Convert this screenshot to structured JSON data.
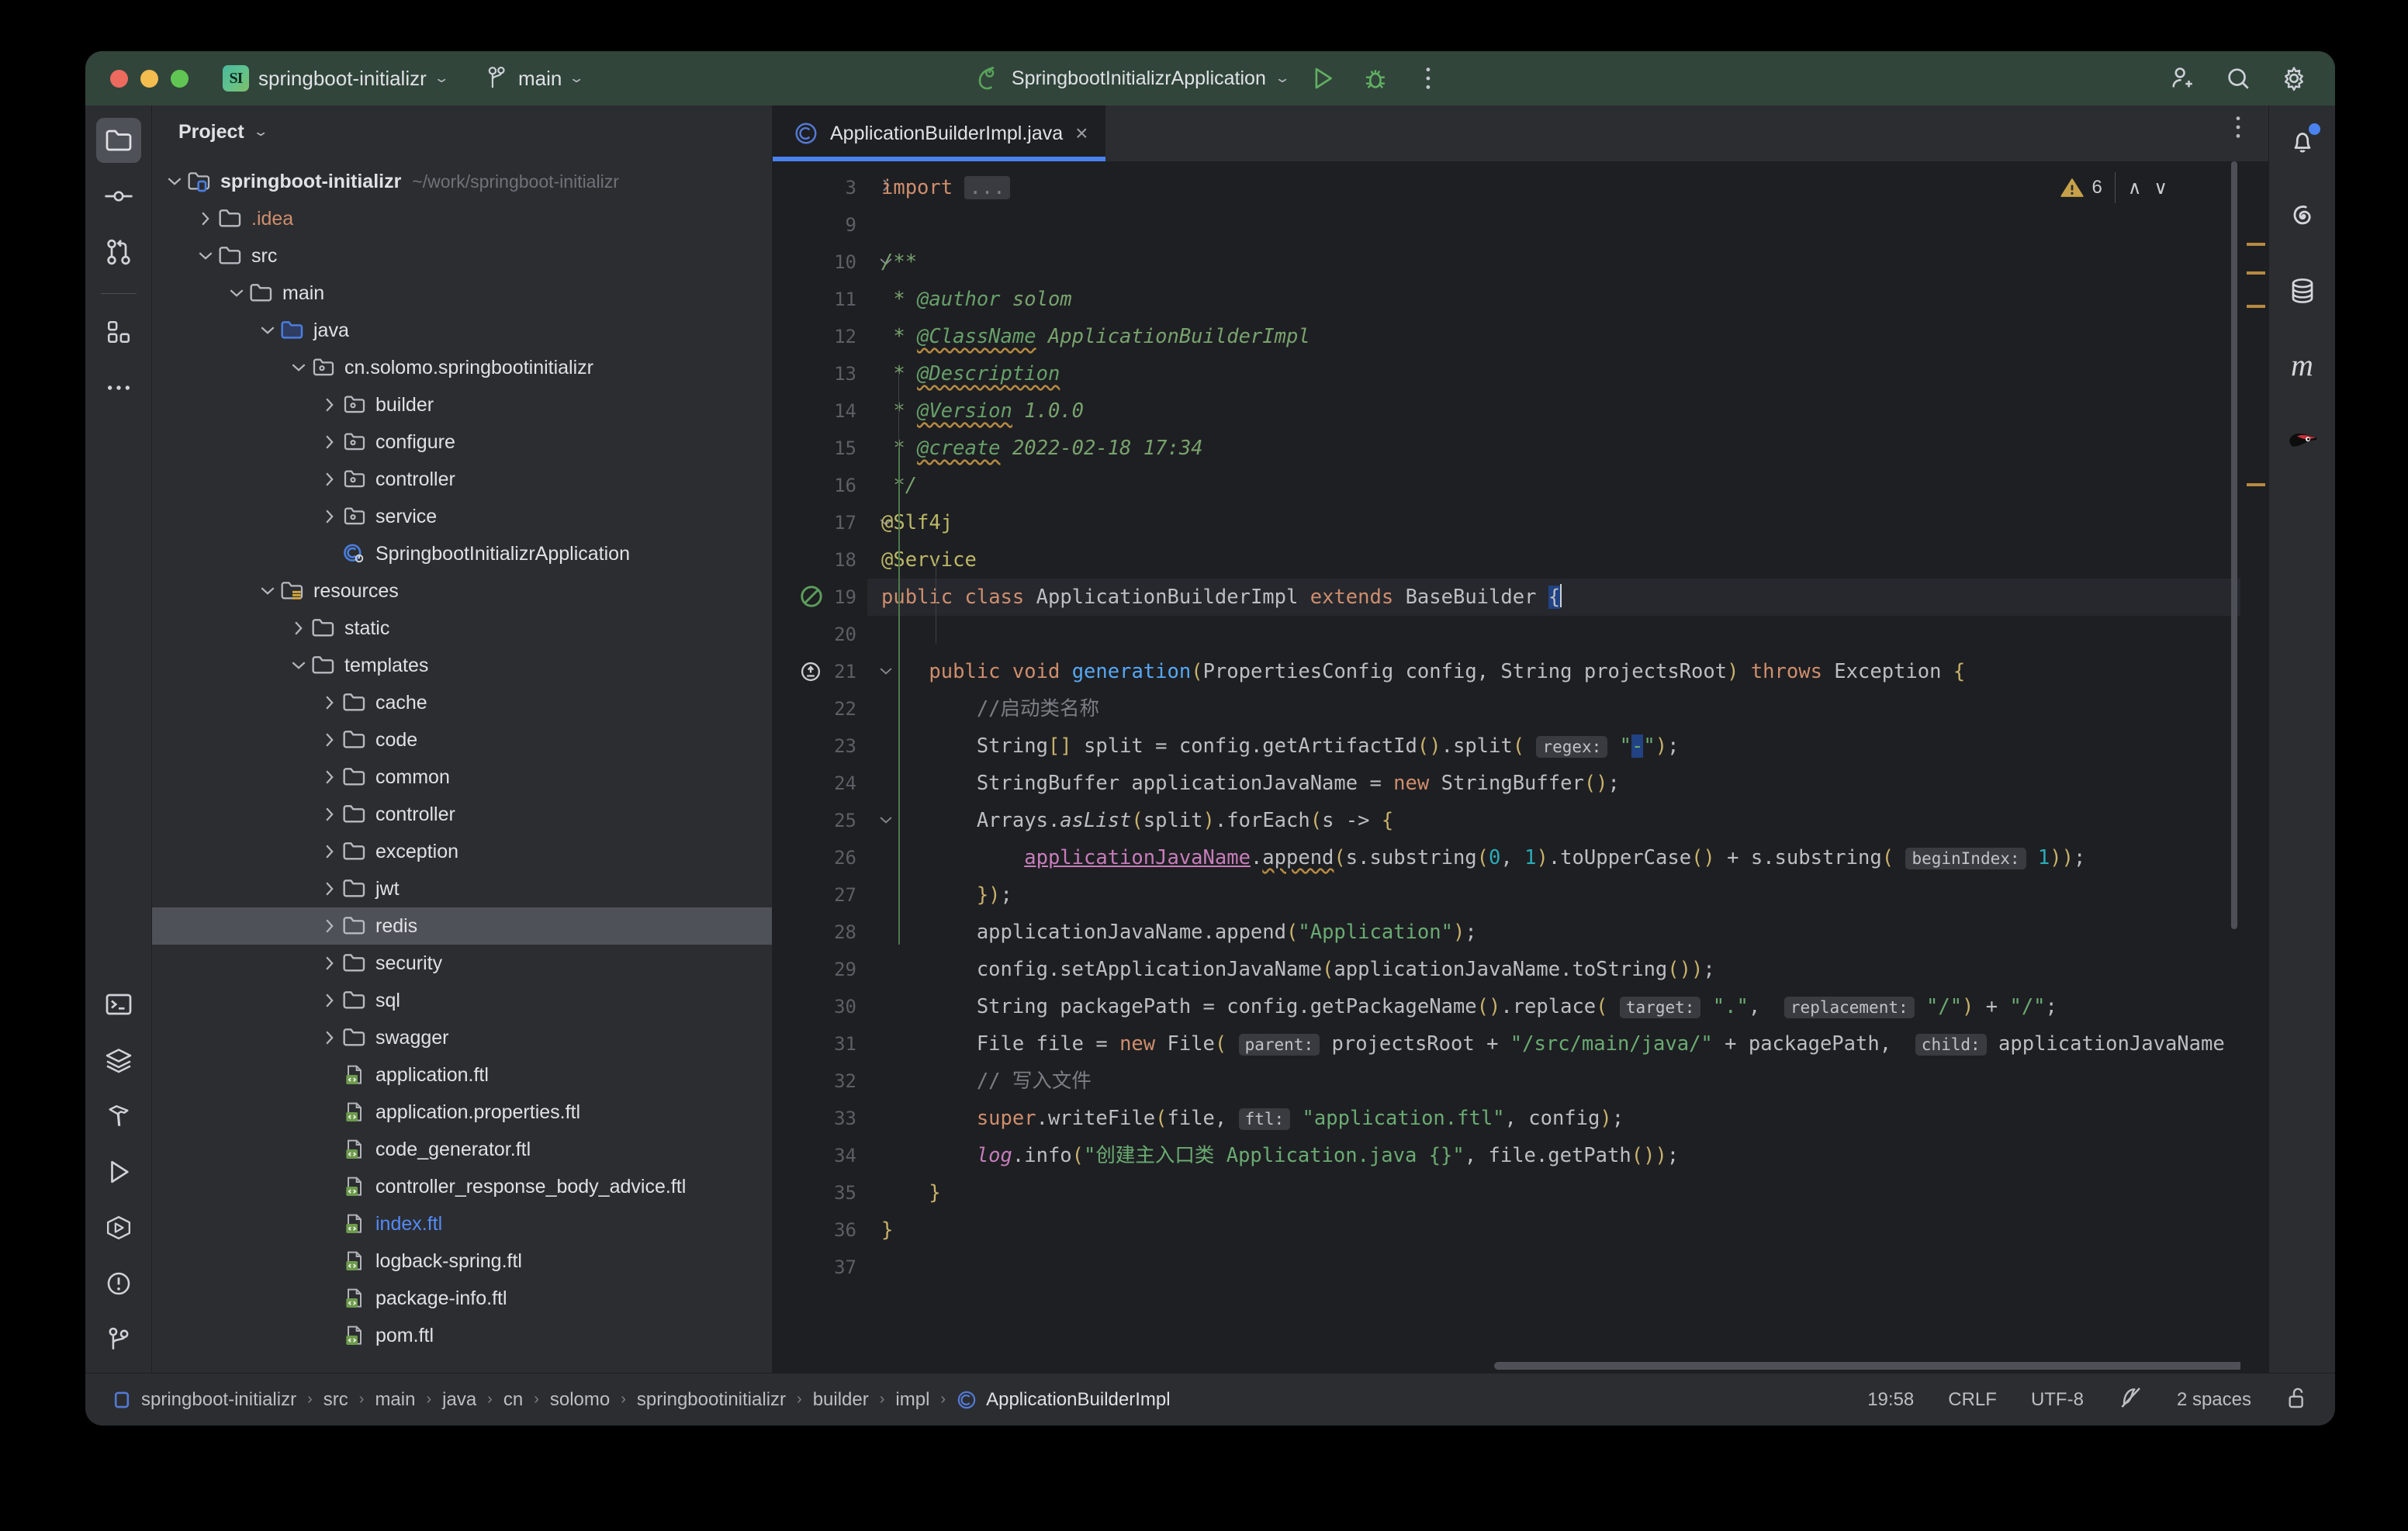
{
  "titlebar": {
    "project_badge": "SI",
    "project_name": "springboot-initializr",
    "branch_name": "main",
    "run_config": "SpringbootInitializrApplication",
    "icons": {
      "run": "run-icon",
      "debug": "debug-icon",
      "more": "more-options-icon",
      "add_user": "add-user-icon",
      "search": "search-icon",
      "settings": "settings-gear-icon"
    }
  },
  "left_rail": {
    "items": [
      {
        "name": "project-tool-window",
        "icon": "folder-icon",
        "active": true
      },
      {
        "name": "commit-tool-window",
        "icon": "commit-icon",
        "active": false
      },
      {
        "name": "pull-requests-tool-window",
        "icon": "pull-request-icon",
        "active": false
      },
      {
        "name": "structure-tool-window",
        "icon": "structure-blocks-icon",
        "active": false
      },
      {
        "name": "more-tool-windows",
        "icon": "ellipsis-icon",
        "active": false
      }
    ],
    "bottom_items": [
      {
        "name": "terminal-tool-window",
        "icon": "terminal-icon"
      },
      {
        "name": "services-tool-window",
        "icon": "layers-icon"
      },
      {
        "name": "build-tool-window",
        "icon": "hammer-icon"
      },
      {
        "name": "run-tool-window",
        "icon": "play-triangle-icon"
      },
      {
        "name": "debug-tool-window",
        "icon": "debug-hex-icon"
      },
      {
        "name": "problems-tool-window",
        "icon": "exclamation-circle-icon"
      },
      {
        "name": "version-control-tool-window",
        "icon": "branch-icon"
      }
    ]
  },
  "right_rail": {
    "items": [
      {
        "name": "notifications",
        "icon": "bell-icon",
        "badge": true
      },
      {
        "name": "spiral-plugin",
        "icon": "spiral-icon",
        "badge": false
      },
      {
        "name": "database",
        "icon": "database-icon",
        "badge": false
      },
      {
        "name": "maven",
        "icon": "maven-m-icon",
        "badge": false
      },
      {
        "name": "ninja-plugin",
        "icon": "ninja-icon",
        "badge": false
      }
    ]
  },
  "project_panel": {
    "title": "Project",
    "tree": [
      {
        "depth": 0,
        "arrow": "down",
        "icon": "module-icon",
        "label": "springboot-initializr",
        "bold": true,
        "sub": "~/work/springboot-initializr"
      },
      {
        "depth": 1,
        "arrow": "right",
        "icon": "folder-icon",
        "label": ".idea",
        "color": "orange"
      },
      {
        "depth": 1,
        "arrow": "down",
        "icon": "folder-icon",
        "label": "src"
      },
      {
        "depth": 2,
        "arrow": "down",
        "icon": "folder-icon",
        "label": "main"
      },
      {
        "depth": 3,
        "arrow": "down",
        "icon": "source-folder-icon",
        "label": "java"
      },
      {
        "depth": 4,
        "arrow": "down",
        "icon": "package-icon",
        "label": "cn.solomo.springbootinitializr"
      },
      {
        "depth": 5,
        "arrow": "right",
        "icon": "package-icon",
        "label": "builder"
      },
      {
        "depth": 5,
        "arrow": "right",
        "icon": "package-icon",
        "label": "configure"
      },
      {
        "depth": 5,
        "arrow": "right",
        "icon": "package-icon",
        "label": "controller"
      },
      {
        "depth": 5,
        "arrow": "right",
        "icon": "package-icon",
        "label": "service"
      },
      {
        "depth": 5,
        "arrow": "none",
        "icon": "spring-class-icon",
        "label": "SpringbootInitializrApplication"
      },
      {
        "depth": 3,
        "arrow": "down",
        "icon": "resources-folder-icon",
        "label": "resources"
      },
      {
        "depth": 4,
        "arrow": "right",
        "icon": "folder-icon",
        "label": "static"
      },
      {
        "depth": 4,
        "arrow": "down",
        "icon": "folder-icon",
        "label": "templates"
      },
      {
        "depth": 5,
        "arrow": "right",
        "icon": "folder-icon",
        "label": "cache"
      },
      {
        "depth": 5,
        "arrow": "right",
        "icon": "folder-icon",
        "label": "code"
      },
      {
        "depth": 5,
        "arrow": "right",
        "icon": "folder-icon",
        "label": "common"
      },
      {
        "depth": 5,
        "arrow": "right",
        "icon": "folder-icon",
        "label": "controller"
      },
      {
        "depth": 5,
        "arrow": "right",
        "icon": "folder-icon",
        "label": "exception"
      },
      {
        "depth": 5,
        "arrow": "right",
        "icon": "folder-icon",
        "label": "jwt"
      },
      {
        "depth": 5,
        "arrow": "right",
        "icon": "folder-icon",
        "label": "redis",
        "selected": true
      },
      {
        "depth": 5,
        "arrow": "right",
        "icon": "folder-icon",
        "label": "security"
      },
      {
        "depth": 5,
        "arrow": "right",
        "icon": "folder-icon",
        "label": "sql"
      },
      {
        "depth": 5,
        "arrow": "right",
        "icon": "folder-icon",
        "label": "swagger"
      },
      {
        "depth": 5,
        "arrow": "none",
        "icon": "ftl-file-icon",
        "label": "application.ftl"
      },
      {
        "depth": 5,
        "arrow": "none",
        "icon": "ftl-file-icon",
        "label": "application.properties.ftl"
      },
      {
        "depth": 5,
        "arrow": "none",
        "icon": "ftl-file-icon",
        "label": "code_generator.ftl"
      },
      {
        "depth": 5,
        "arrow": "none",
        "icon": "ftl-file-icon",
        "label": "controller_response_body_advice.ftl"
      },
      {
        "depth": 5,
        "arrow": "none",
        "icon": "ftl-file-icon",
        "label": "index.ftl",
        "color": "blue"
      },
      {
        "depth": 5,
        "arrow": "none",
        "icon": "ftl-file-icon",
        "label": "logback-spring.ftl"
      },
      {
        "depth": 5,
        "arrow": "none",
        "icon": "ftl-file-icon",
        "label": "package-info.ftl"
      },
      {
        "depth": 5,
        "arrow": "none",
        "icon": "ftl-file-icon",
        "label": "pom.ftl"
      }
    ]
  },
  "editor": {
    "tab": {
      "icon": "java-class-icon",
      "name": "ApplicationBuilderImpl.java",
      "close": "×"
    },
    "tab_options_icon": "more-vertical-icon",
    "inspection": {
      "icon": "warning-triangle-icon",
      "count": "6",
      "up": "∧",
      "down": "∨"
    },
    "line_numbers": [
      "3",
      "9",
      "10",
      "11",
      "12",
      "13",
      "14",
      "15",
      "16",
      "17",
      "18",
      "19",
      "20",
      "21",
      "22",
      "23",
      "24",
      "25",
      "26",
      "27",
      "28",
      "29",
      "30",
      "31",
      "32",
      "33",
      "34",
      "35",
      "36",
      "37"
    ],
    "code_lines": [
      "import ...",
      "",
      "/**",
      " * @author solom",
      " * @ClassName ApplicationBuilderImpl",
      " * @Description",
      " * @Version 1.0.0",
      " * @create 2022-02-18 17:34",
      " */",
      "@Slf4j",
      "@Service",
      "public class ApplicationBuilderImpl extends BaseBuilder {",
      "",
      "    public void generation(PropertiesConfig config, String projectsRoot) throws Exception {",
      "        //启动类名称",
      "        String[] split = config.getArtifactId().split( regex: \"-\");",
      "        StringBuffer applicationJavaName = new StringBuffer();",
      "        Arrays.asList(split).forEach(s -> {",
      "            applicationJavaName.append(s.substring(0, 1).toUpperCase() + s.substring( beginIndex: 1));",
      "        });",
      "        applicationJavaName.append(\"Application\");",
      "        config.setApplicationJavaName(applicationJavaName.toString());",
      "        String packagePath = config.getPackageName().replace( target: \".\",  replacement: \"/\") + \"/\";",
      "        File file = new File( parent: projectsRoot + \"/src/main/java/\" + packagePath,  child: applicationJavaName",
      "        // 写入文件",
      "        super.writeFile(file,  ftl: \"application.ftl\", config);",
      "        log.info(\"创建主入口类 Application.java {}\", file.getPath());",
      "    }",
      "}",
      ""
    ]
  },
  "status_bar": {
    "breadcrumbs": [
      "springboot-initializr",
      "src",
      "main",
      "java",
      "cn",
      "solomo",
      "springbootinitializr",
      "builder",
      "impl",
      "ApplicationBuilderImpl"
    ],
    "breadcrumb_first_icon": "module-icon",
    "breadcrumb_last_icon": "java-class-icon",
    "separator": "›",
    "position": "19:58",
    "line_separator": "CRLF",
    "encoding": "UTF-8",
    "inspection_icon": "inspections-off-icon",
    "indent": "2 spaces",
    "lock_icon": "unlocked-icon"
  }
}
